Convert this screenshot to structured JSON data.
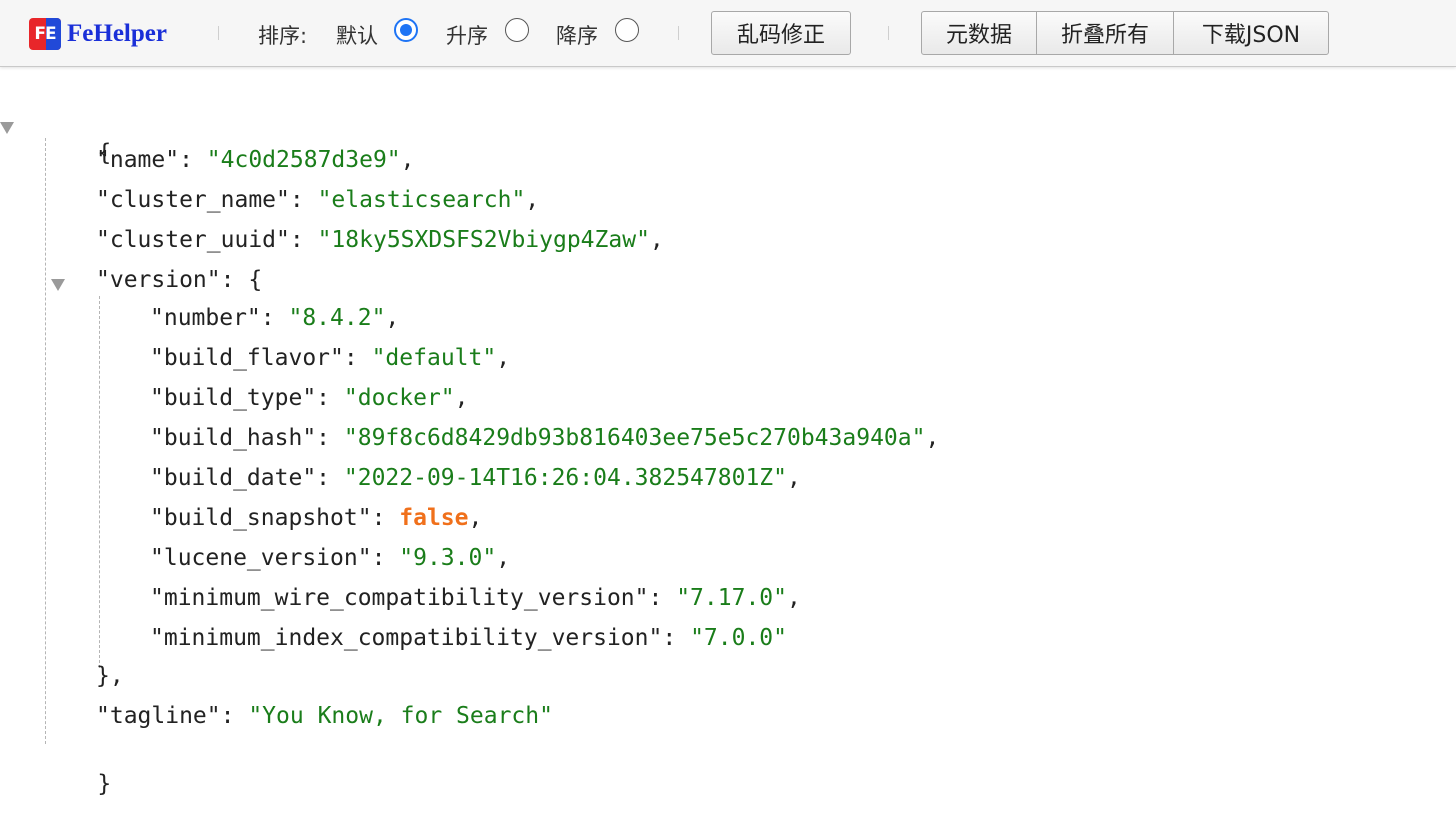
{
  "toolbar": {
    "logo_badge": "FE",
    "logo_text": "FeHelper",
    "sort_label": "排序:",
    "sort_options": [
      {
        "label": "默认",
        "checked": true
      },
      {
        "label": "升序",
        "checked": false
      },
      {
        "label": "降序",
        "checked": false
      }
    ],
    "fix_encoding_button": "乱码修正",
    "metadata_button": "元数据",
    "collapse_all_button": "折叠所有",
    "download_json_button": "下载JSON"
  },
  "colors": {
    "string": "#1a7d1a",
    "boolean": "#f0701b",
    "brand_blue": "#1a2fd8",
    "radio_accent": "#1e74f5"
  },
  "json": {
    "open_brace": "{",
    "close_brace": "}",
    "entries": [
      {
        "key": "\"name\"",
        "value": "\"4c0d2587d3e9\"",
        "type": "string",
        "comma": ","
      },
      {
        "key": "\"cluster_name\"",
        "value": "\"elasticsearch\"",
        "type": "string",
        "comma": ","
      },
      {
        "key": "\"cluster_uuid\"",
        "value": "\"18ky5SXDSFS2Vbiygp4Zaw\"",
        "type": "string",
        "comma": ","
      }
    ],
    "version": {
      "key": "\"version\"",
      "open": "{",
      "close": "},",
      "entries": [
        {
          "key": "\"number\"",
          "value": "\"8.4.2\"",
          "type": "string",
          "comma": ","
        },
        {
          "key": "\"build_flavor\"",
          "value": "\"default\"",
          "type": "string",
          "comma": ","
        },
        {
          "key": "\"build_type\"",
          "value": "\"docker\"",
          "type": "string",
          "comma": ","
        },
        {
          "key": "\"build_hash\"",
          "value": "\"89f8c6d8429db93b816403ee75e5c270b43a940a\"",
          "type": "string",
          "comma": ","
        },
        {
          "key": "\"build_date\"",
          "value": "\"2022-09-14T16:26:04.382547801Z\"",
          "type": "string",
          "comma": ","
        },
        {
          "key": "\"build_snapshot\"",
          "value": "false",
          "type": "boolean",
          "comma": ","
        },
        {
          "key": "\"lucene_version\"",
          "value": "\"9.3.0\"",
          "type": "string",
          "comma": ","
        },
        {
          "key": "\"minimum_wire_compatibility_version\"",
          "value": "\"7.17.0\"",
          "type": "string",
          "comma": ","
        },
        {
          "key": "\"minimum_index_compatibility_version\"",
          "value": "\"7.0.0\"",
          "type": "string",
          "comma": ""
        }
      ]
    },
    "tagline": {
      "key": "\"tagline\"",
      "value": "\"You Know, for Search\"",
      "type": "string",
      "comma": ""
    }
  }
}
